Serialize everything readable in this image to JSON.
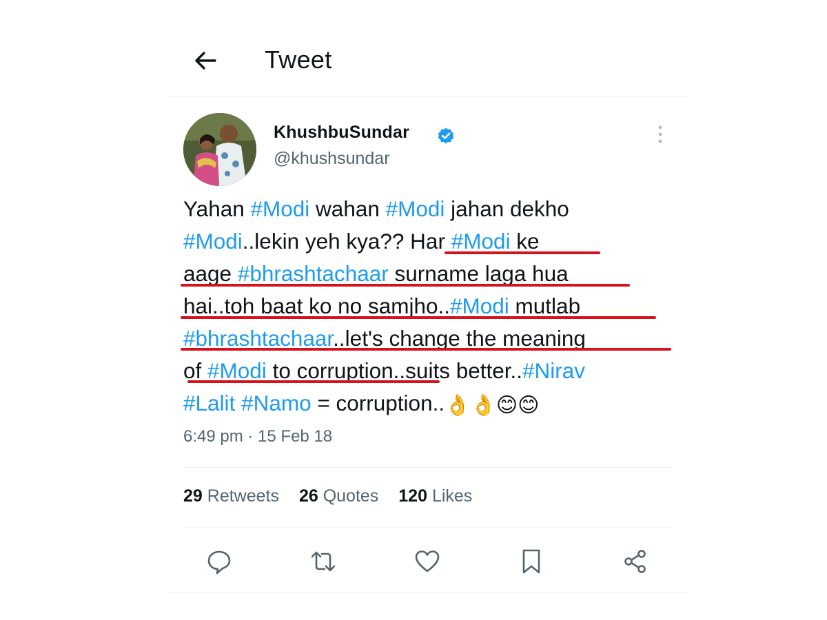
{
  "header": {
    "title": "Tweet",
    "back_icon": "arrow-left-icon"
  },
  "author": {
    "name": "KhushbuSundar",
    "handle": "@khushsundar",
    "verified": true,
    "verified_color": "#1d9bf0"
  },
  "tweet": {
    "line1": {
      "a": "Yahan ",
      "b": "#Modi",
      "c": " wahan ",
      "d": "#Modi",
      "e": " jahan dekho"
    },
    "line2": {
      "a": "#Modi",
      "b": "..lekin yeh kya?? Har ",
      "c": "#Modi",
      "d": " ke"
    },
    "line3": {
      "a": "aage ",
      "b": "#bhrashtachaar",
      "c": " surname laga hua"
    },
    "line4": {
      "a": "hai..toh baat ko no samjho..",
      "b": "#Modi",
      "c": " mutlab"
    },
    "line5": {
      "a": "#bhrashtachaar",
      "b": "..let's change the meaning"
    },
    "line6": {
      "a": "of ",
      "b": "#Modi",
      "c": " to corruption..suits better..",
      "d": "#Nirav"
    },
    "line7": {
      "a": "#Lalit",
      "b": " ",
      "c": "#Namo",
      "d": " = corruption..",
      "emoji": "👌👌😊😊"
    },
    "timestamp": "6:49 pm · 15 Feb 18",
    "hashtag_color": "#1d9bf0",
    "annotation_underline_color": "#d6131c"
  },
  "stats": {
    "retweets": {
      "count": "29",
      "label": "Retweets"
    },
    "quotes": {
      "count": "26",
      "label": "Quotes"
    },
    "likes": {
      "count": "120",
      "label": "Likes"
    }
  },
  "actions": [
    "reply-icon",
    "retweet-icon",
    "like-icon",
    "bookmark-icon",
    "share-icon"
  ]
}
